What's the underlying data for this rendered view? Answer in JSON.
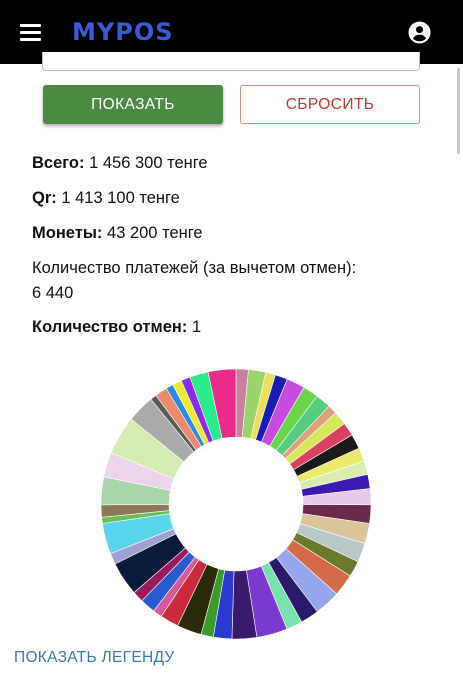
{
  "app": {
    "logo_text": "MYPOS"
  },
  "icons": {
    "menu": "hamburger-menu-icon",
    "account": "account-circle-icon"
  },
  "colors": {
    "topbar": "#000000",
    "logo": "#3b5bd6",
    "primary": "#4b8a43",
    "danger": "#c0392b",
    "link": "#3a78b5"
  },
  "buttons": {
    "show": "ПОКАЗАТЬ",
    "reset": "СБРОСИТЬ"
  },
  "stats": {
    "total_label": "Всего:",
    "total_value": "1 456 300 тенге",
    "qr_label": "Qr:",
    "qr_value": "1 413 100 тенге",
    "coins_label": "Монеты:",
    "coins_value": "43 200 тенге",
    "payments_label": "Количество платежей (за вычетом отмен):",
    "payments_value": "6 440",
    "cancels_label": "Количество отмен:",
    "cancels_value": "1"
  },
  "chart_data": {
    "type": "pie",
    "variant": "donut",
    "values": [
      2.0,
      2.8,
      1.6,
      2.0,
      3.0,
      2.5,
      2.5,
      1.5,
      2.2,
      2.2,
      2.4,
      2.2,
      2.2,
      2.3,
      2.6,
      3.0,
      3.3,
      3.1,
      2.6,
      3.6,
      4.2,
      3.0,
      2.6,
      5.0,
      4.0,
      3.0,
      2.0,
      4.0,
      3.0,
      1.5,
      2.5,
      1.8,
      5.5,
      1.8,
      5.0,
      1.0,
      2.0,
      4.5,
      4.0,
      6.3,
      4.5,
      1.0,
      2.0,
      1.2,
      1.5,
      1.5,
      3.0,
      4.5
    ],
    "colors": [
      "#c97fa0",
      "#9bd46a",
      "#ece05a",
      "#1a1ab8",
      "#c64ce0",
      "#6ad44a",
      "#56cc7e",
      "#dca07a",
      "#d6e85a",
      "#d94060",
      "#1a1a1a",
      "#eaea6a",
      "#d8ecb0",
      "#3a1ab0",
      "#e8c8ec",
      "#6a2a4a",
      "#dcc49a",
      "#b8c8c8",
      "#6a7a2a",
      "#d46a4a",
      "#96a6ec",
      "#2a1a6a",
      "#7ae0b0",
      "#7a3ad0",
      "#3a1a6a",
      "#2a3ad0",
      "#3a9a2a",
      "#2a2a0a",
      "#cc2a3a",
      "#d45a9a",
      "#2a5ad0",
      "#9a1a5a",
      "#0a1a3a",
      "#a0a0d4",
      "#5ad6ec",
      "#6abe5a",
      "#8a7a5a",
      "#aad4aa",
      "#ecd4ec",
      "#d4ecb4",
      "#aaaaaa",
      "#5a5a5a",
      "#ec8a6a",
      "#2a8aec",
      "#ecec2a",
      "#8a2aec",
      "#2aec8a",
      "#ec2a8a"
    ]
  },
  "legend": {
    "show_label": "ПОКАЗАТЬ ЛЕГЕНДУ"
  }
}
